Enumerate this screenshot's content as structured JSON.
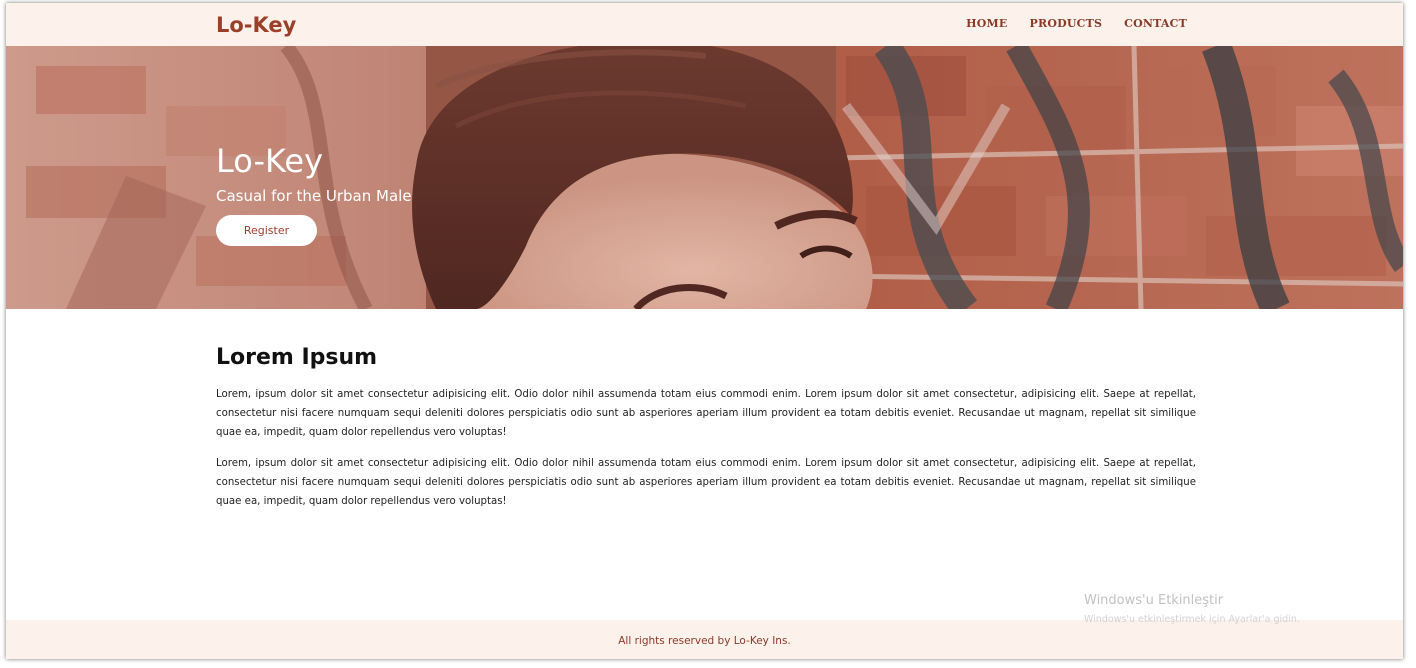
{
  "navbar": {
    "brand": "Lo-Key",
    "links": [
      "HOME",
      "PRODUCTS",
      "CONTACT"
    ]
  },
  "hero": {
    "title": "Lo-Key",
    "subtitle": "Casual for the Urban Male",
    "register_label": "Register"
  },
  "content": {
    "heading": "Lorem Ipsum",
    "paragraphs": [
      "Lorem, ipsum dolor sit amet consectetur adipisicing elit. Odio dolor nihil assumenda totam eius commodi enim. Lorem ipsum dolor sit amet consectetur, adipisicing elit. Saepe at repellat, consectetur nisi facere numquam sequi deleniti dolores perspiciatis odio sunt ab asperiores aperiam illum provident ea totam debitis eveniet. Recusandae ut magnam, repellat sit similique quae ea, impedit, quam dolor repellendus vero voluptas!",
      "Lorem, ipsum dolor sit amet consectetur adipisicing elit. Odio dolor nihil assumenda totam eius commodi enim. Lorem ipsum dolor sit amet consectetur, adipisicing elit. Saepe at repellat, consectetur nisi facere numquam sequi deleniti dolores perspiciatis odio sunt ab asperiores aperiam illum provident ea totam debitis eveniet. Recusandae ut magnam, repellat sit similique quae ea, impedit, quam dolor repellendus vero voluptas!"
    ]
  },
  "footer": {
    "text": "All rights reserved by Lo-Key Ins."
  },
  "watermark": {
    "line1": "Windows'u Etkinleştir",
    "line2": "Windows'u etkinleştirmek için Ayarlar'a gidin."
  },
  "colors": {
    "brand": "#9b3f29",
    "nav_bg": "#fdf1ec",
    "button_bg": "#ffffff"
  }
}
